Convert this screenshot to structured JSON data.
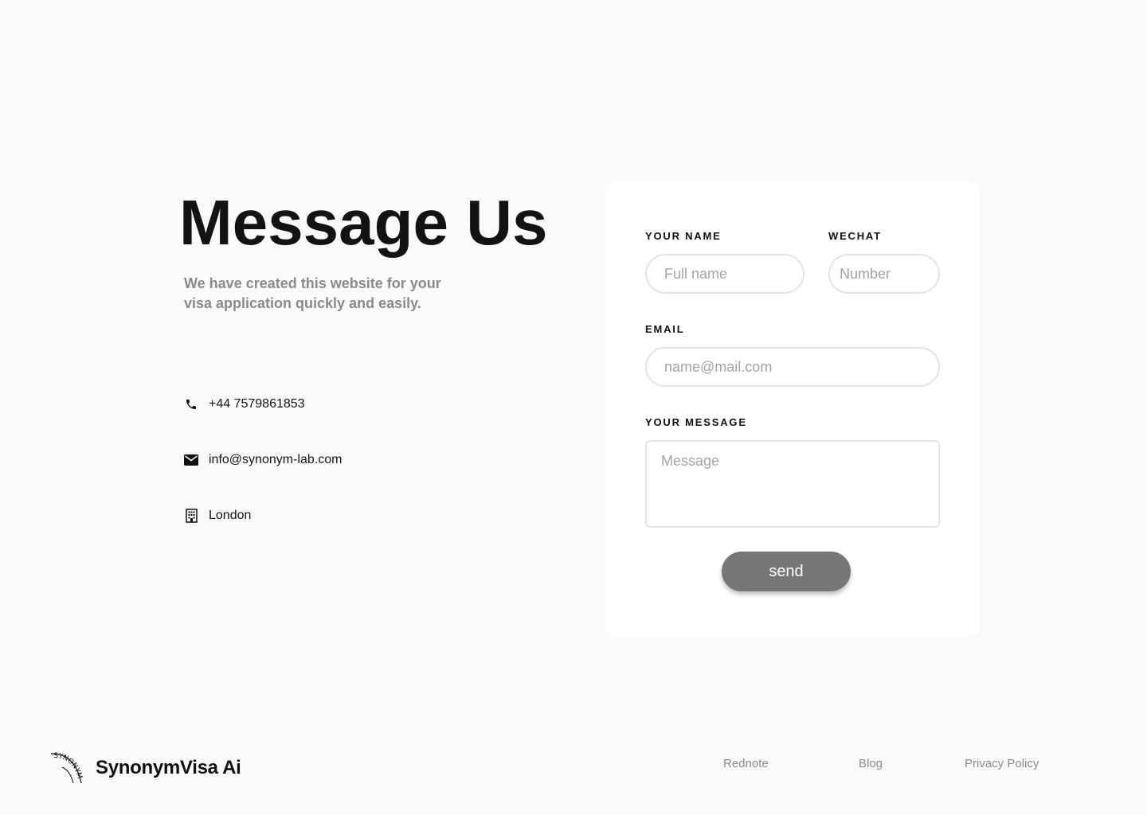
{
  "hero": {
    "title": "Message Us",
    "subtitle": "We have created this website for your visa application quickly and easily."
  },
  "contact": {
    "phone": {
      "icon": "phone-icon",
      "text": "+44 7579861853"
    },
    "email": {
      "icon": "envelope-icon",
      "text": "info@synonym-lab.com"
    },
    "location": {
      "icon": "building-icon",
      "text": "London"
    }
  },
  "form": {
    "name_label": "YOUR NAME",
    "name_placeholder": "Full name",
    "wechat_label": "WECHAT",
    "wechat_placeholder": "Number",
    "email_label": "EMAIL",
    "email_placeholder": "name@mail.com",
    "message_label": "YOUR MESSAGE",
    "message_placeholder": "Message",
    "send_label": "send"
  },
  "footer": {
    "logo_text": "SYNONYM",
    "brand": "SynonymVisa Ai",
    "links": [
      "Rednote",
      "Blog",
      "Privacy Policy"
    ]
  },
  "colors": {
    "background": "#fbfaf8",
    "card": "#ffffff",
    "button": "#777777",
    "muted_text": "#8a8a8a"
  }
}
